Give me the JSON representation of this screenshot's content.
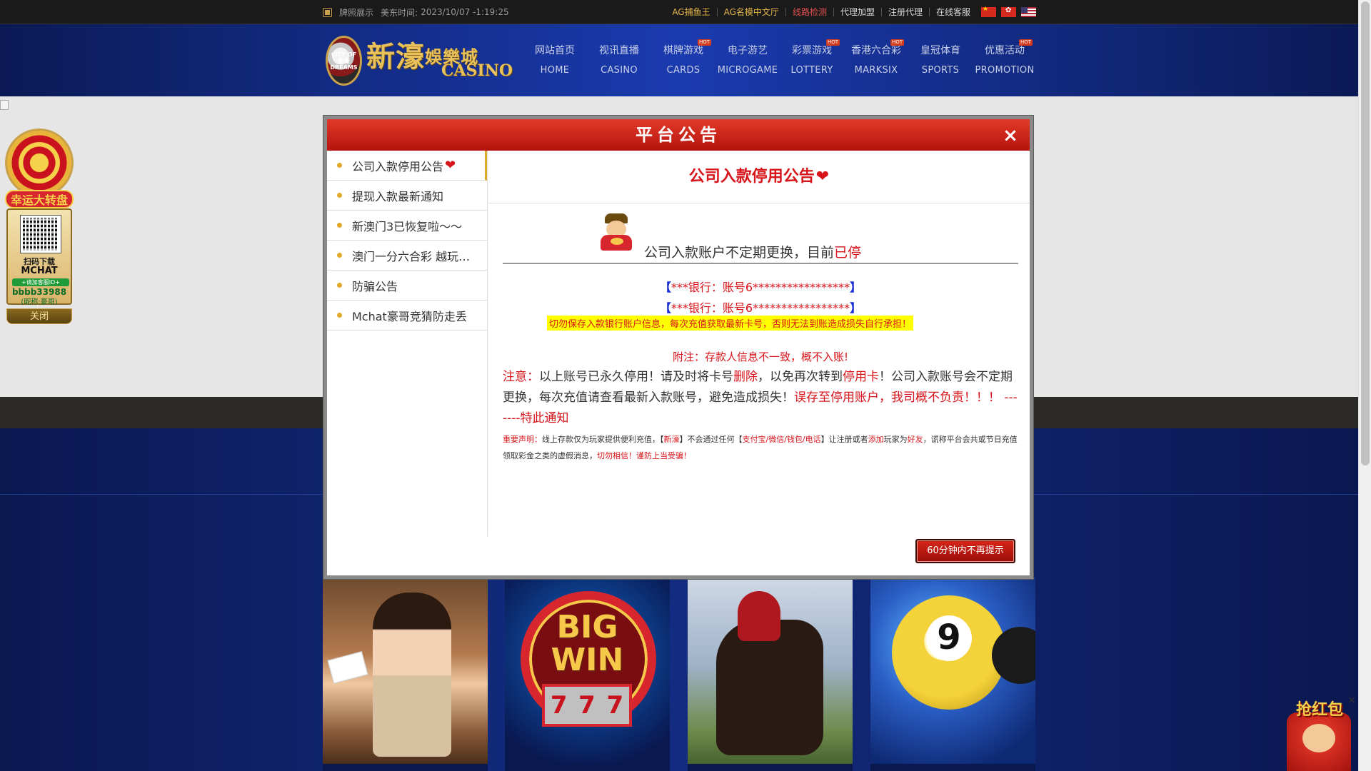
{
  "topbar": {
    "license": "牌照展示",
    "time_label": "美东时间:",
    "time_value": "2023/10/07 -1:19:25",
    "links": [
      "AG捕鱼王",
      "AG名模中文厅",
      "线路检测",
      "代理加盟",
      "注册代理",
      "在线客服"
    ],
    "flags": [
      "flag-cn",
      "flag-hk",
      "flag-us"
    ]
  },
  "logo": {
    "disc_text": "CITY OF 新濠 DREAMS",
    "cn_name": "新濠",
    "cn_suffix": "娛樂城",
    "en_name": "CASINO"
  },
  "nav": [
    {
      "cn": "网站首页",
      "en": "HOME",
      "hot": false
    },
    {
      "cn": "视讯直播",
      "en": "CASINO",
      "hot": false
    },
    {
      "cn": "棋牌游戏",
      "en": "CARDS",
      "hot": true
    },
    {
      "cn": "电子游艺",
      "en": "MICROGAME",
      "hot": false
    },
    {
      "cn": "彩票游戏",
      "en": "LOTTERY",
      "hot": true
    },
    {
      "cn": "香港六合彩",
      "en": "MARKSIX",
      "hot": true
    },
    {
      "cn": "皇冠体育",
      "en": "SPORTS",
      "hot": false
    },
    {
      "cn": "优惠活动",
      "en": "PROMOTION",
      "hot": true
    }
  ],
  "hot_label": "HOT",
  "left_ad": {
    "banner": "幸运大转盘",
    "scan": "扫码下载",
    "app": "MCHAT",
    "add": "+请加客服ID+",
    "id": "bbbb33988",
    "nick": "(昵称:豪哥)",
    "close": "关闭"
  },
  "red_envelope": {
    "text": "抢红包",
    "close": "×"
  },
  "modal": {
    "title": "平台公告",
    "close": "×",
    "sidebar": [
      "公司入款停用公告",
      "提现入款最新通知",
      "新澳门3已恢复啦～～",
      "澳门一分六合彩 越玩越…",
      "防骗公告",
      "Mchat豪哥竞猜防走丢"
    ],
    "heart": "❤",
    "content": {
      "title": "公司入款停用公告",
      "line1": "公司入款账户不定期更换，目前",
      "line1_red": "已停",
      "acc_open": "【",
      "acc_close": "】",
      "acc1": "***银行：账号6*****************",
      "acc2": "***银行：账号6*****************",
      "warn": "切勿保存入款银行账户信息，每次充值获取最新卡号，否则无法到账造成损失自行承担！",
      "note": "附注：存款人信息不一致，概不入账!",
      "notice_label": "注意：",
      "notice_a": "以上账号已永久停用！请及时将卡号",
      "notice_del": "删除",
      "notice_b": "，以免再次转到",
      "notice_stop": "停用卡",
      "notice_c": "！公司入款账号会不定期更换，每次充值请查看最新入款账号，避免造成损失！",
      "notice_d": "误存至停用账户，我司概不负责！！！ -------特此通知",
      "decl_label": "重要声明：",
      "decl_a": "线上存款仅为玩家提供便利充值，【",
      "decl_brand": "新濠",
      "decl_b": "】不会通过任何【",
      "decl_pay": "支付宝/微信/钱包/电话",
      "decl_c": "】让注册或者",
      "decl_add": "添加",
      "decl_d": "玩家为",
      "decl_friend": "好友",
      "decl_e": "，谎称平台会共或节日充值领取彩金之类的虚假消息，",
      "decl_f": "切勿相信！谨防上当受骗！"
    },
    "ok_button": "60分钟内不再提示"
  },
  "colors": {
    "accent_red": "#d7141a",
    "gold": "#e2a82a",
    "nav_blue": "#1a3bb0"
  }
}
